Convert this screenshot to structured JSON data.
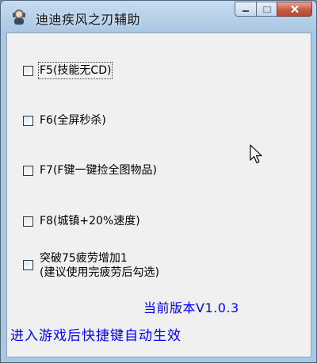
{
  "window": {
    "title": "迪迪疾风之刃辅助",
    "buttons": {
      "minimize": "minimize",
      "maximize": "maximize",
      "close": "close"
    }
  },
  "options": [
    {
      "key": "f5",
      "label": "F5(技能无CD)",
      "checked": false
    },
    {
      "key": "f6",
      "label": "F6(全屏秒杀)",
      "checked": false
    },
    {
      "key": "f7",
      "label": "F7(F键一键捡全图物品)",
      "checked": false
    },
    {
      "key": "f8",
      "label": "F8(城镇+20%速度)",
      "checked": false
    },
    {
      "key": "fatigue",
      "label": "突破75疲劳增加1\n(建议使用完疲劳后勾选)",
      "checked": false
    }
  ],
  "version_text": "当前版本V1.0.3",
  "footer_text": "进入游戏后快捷键自动生效",
  "colors": {
    "accent_text": "#0000ff",
    "close_button": "#c75a43"
  }
}
